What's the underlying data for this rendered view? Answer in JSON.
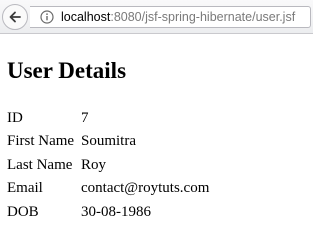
{
  "browser": {
    "url_host": "localhost",
    "url_rest": ":8080/jsf-spring-hibernate/user.jsf",
    "back_icon": "back-arrow-icon",
    "info_icon": "info-icon"
  },
  "page": {
    "title": "User Details",
    "rows": [
      {
        "label": "ID",
        "value": "7"
      },
      {
        "label": "First Name",
        "value": "Soumitra"
      },
      {
        "label": "Last Name",
        "value": "Roy"
      },
      {
        "label": "Email",
        "value": "contact@roytuts.com"
      },
      {
        "label": "DOB",
        "value": "30-08-1986"
      }
    ]
  },
  "colors": {
    "toolbar_bg": "#ecedef",
    "url_secondary": "#7a7a7a"
  }
}
